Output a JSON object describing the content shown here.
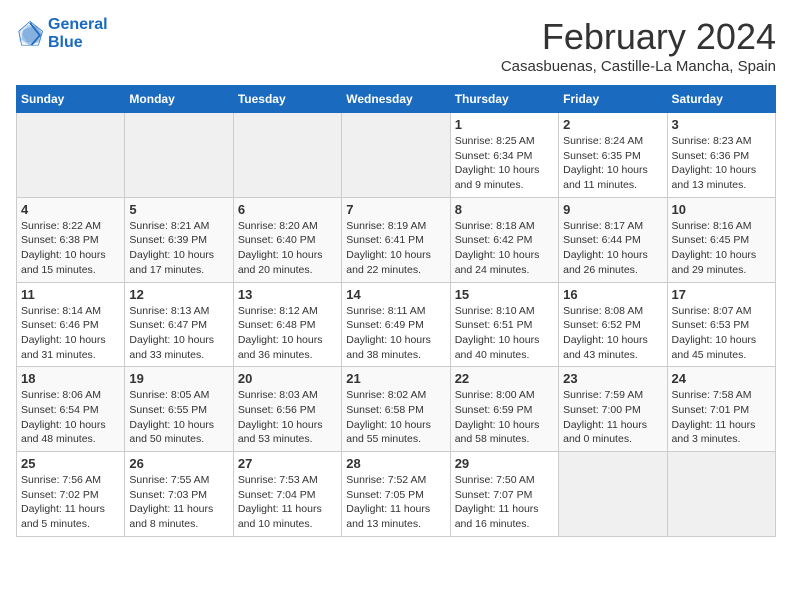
{
  "header": {
    "logo_line1": "General",
    "logo_line2": "Blue",
    "title": "February 2024",
    "subtitle": "Casasbuenas, Castille-La Mancha, Spain"
  },
  "days_of_week": [
    "Sunday",
    "Monday",
    "Tuesday",
    "Wednesday",
    "Thursday",
    "Friday",
    "Saturday"
  ],
  "weeks": [
    [
      {
        "day": "",
        "info": ""
      },
      {
        "day": "",
        "info": ""
      },
      {
        "day": "",
        "info": ""
      },
      {
        "day": "",
        "info": ""
      },
      {
        "day": "1",
        "info": "Sunrise: 8:25 AM\nSunset: 6:34 PM\nDaylight: 10 hours\nand 9 minutes."
      },
      {
        "day": "2",
        "info": "Sunrise: 8:24 AM\nSunset: 6:35 PM\nDaylight: 10 hours\nand 11 minutes."
      },
      {
        "day": "3",
        "info": "Sunrise: 8:23 AM\nSunset: 6:36 PM\nDaylight: 10 hours\nand 13 minutes."
      }
    ],
    [
      {
        "day": "4",
        "info": "Sunrise: 8:22 AM\nSunset: 6:38 PM\nDaylight: 10 hours\nand 15 minutes."
      },
      {
        "day": "5",
        "info": "Sunrise: 8:21 AM\nSunset: 6:39 PM\nDaylight: 10 hours\nand 17 minutes."
      },
      {
        "day": "6",
        "info": "Sunrise: 8:20 AM\nSunset: 6:40 PM\nDaylight: 10 hours\nand 20 minutes."
      },
      {
        "day": "7",
        "info": "Sunrise: 8:19 AM\nSunset: 6:41 PM\nDaylight: 10 hours\nand 22 minutes."
      },
      {
        "day": "8",
        "info": "Sunrise: 8:18 AM\nSunset: 6:42 PM\nDaylight: 10 hours\nand 24 minutes."
      },
      {
        "day": "9",
        "info": "Sunrise: 8:17 AM\nSunset: 6:44 PM\nDaylight: 10 hours\nand 26 minutes."
      },
      {
        "day": "10",
        "info": "Sunrise: 8:16 AM\nSunset: 6:45 PM\nDaylight: 10 hours\nand 29 minutes."
      }
    ],
    [
      {
        "day": "11",
        "info": "Sunrise: 8:14 AM\nSunset: 6:46 PM\nDaylight: 10 hours\nand 31 minutes."
      },
      {
        "day": "12",
        "info": "Sunrise: 8:13 AM\nSunset: 6:47 PM\nDaylight: 10 hours\nand 33 minutes."
      },
      {
        "day": "13",
        "info": "Sunrise: 8:12 AM\nSunset: 6:48 PM\nDaylight: 10 hours\nand 36 minutes."
      },
      {
        "day": "14",
        "info": "Sunrise: 8:11 AM\nSunset: 6:49 PM\nDaylight: 10 hours\nand 38 minutes."
      },
      {
        "day": "15",
        "info": "Sunrise: 8:10 AM\nSunset: 6:51 PM\nDaylight: 10 hours\nand 40 minutes."
      },
      {
        "day": "16",
        "info": "Sunrise: 8:08 AM\nSunset: 6:52 PM\nDaylight: 10 hours\nand 43 minutes."
      },
      {
        "day": "17",
        "info": "Sunrise: 8:07 AM\nSunset: 6:53 PM\nDaylight: 10 hours\nand 45 minutes."
      }
    ],
    [
      {
        "day": "18",
        "info": "Sunrise: 8:06 AM\nSunset: 6:54 PM\nDaylight: 10 hours\nand 48 minutes."
      },
      {
        "day": "19",
        "info": "Sunrise: 8:05 AM\nSunset: 6:55 PM\nDaylight: 10 hours\nand 50 minutes."
      },
      {
        "day": "20",
        "info": "Sunrise: 8:03 AM\nSunset: 6:56 PM\nDaylight: 10 hours\nand 53 minutes."
      },
      {
        "day": "21",
        "info": "Sunrise: 8:02 AM\nSunset: 6:58 PM\nDaylight: 10 hours\nand 55 minutes."
      },
      {
        "day": "22",
        "info": "Sunrise: 8:00 AM\nSunset: 6:59 PM\nDaylight: 10 hours\nand 58 minutes."
      },
      {
        "day": "23",
        "info": "Sunrise: 7:59 AM\nSunset: 7:00 PM\nDaylight: 11 hours\nand 0 minutes."
      },
      {
        "day": "24",
        "info": "Sunrise: 7:58 AM\nSunset: 7:01 PM\nDaylight: 11 hours\nand 3 minutes."
      }
    ],
    [
      {
        "day": "25",
        "info": "Sunrise: 7:56 AM\nSunset: 7:02 PM\nDaylight: 11 hours\nand 5 minutes."
      },
      {
        "day": "26",
        "info": "Sunrise: 7:55 AM\nSunset: 7:03 PM\nDaylight: 11 hours\nand 8 minutes."
      },
      {
        "day": "27",
        "info": "Sunrise: 7:53 AM\nSunset: 7:04 PM\nDaylight: 11 hours\nand 10 minutes."
      },
      {
        "day": "28",
        "info": "Sunrise: 7:52 AM\nSunset: 7:05 PM\nDaylight: 11 hours\nand 13 minutes."
      },
      {
        "day": "29",
        "info": "Sunrise: 7:50 AM\nSunset: 7:07 PM\nDaylight: 11 hours\nand 16 minutes."
      },
      {
        "day": "",
        "info": ""
      },
      {
        "day": "",
        "info": ""
      }
    ]
  ]
}
